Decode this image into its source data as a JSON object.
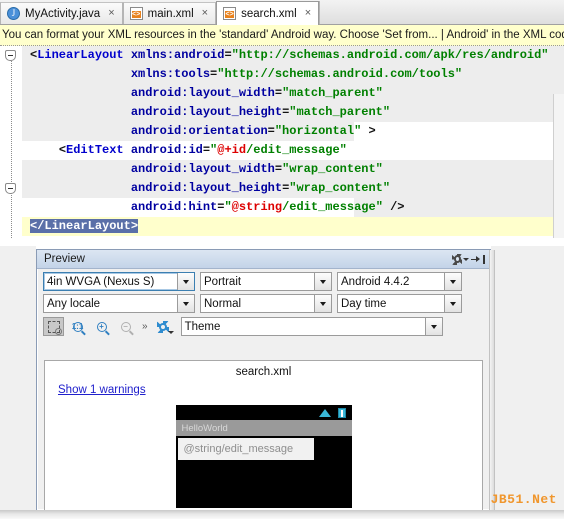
{
  "tabs": [
    {
      "label": "MyActivity.java",
      "icon": "java-file-icon",
      "active": false,
      "close": "×"
    },
    {
      "label": "main.xml",
      "icon": "xml-file-icon",
      "active": false,
      "close": "×"
    },
    {
      "label": "search.xml",
      "icon": "xml-file-icon",
      "active": true,
      "close": "×"
    }
  ],
  "banner": {
    "text": "You can format your XML resources in the 'standard' Android way. Choose 'Set from... | Android' in the XML code sty"
  },
  "editor": {
    "lines": [
      {
        "indent": 0,
        "tokens": [
          {
            "t": "punct",
            "s": "<"
          },
          {
            "t": "tag",
            "s": "LinearLayout"
          },
          {
            "t": "plain",
            "s": " "
          },
          {
            "t": "attr",
            "s": "xmlns:android"
          },
          {
            "t": "punct",
            "s": "="
          },
          {
            "t": "val",
            "s": "\"http://schemas.android.com/apk/res/android\""
          }
        ]
      },
      {
        "indent": 14,
        "tokens": [
          {
            "t": "attr",
            "s": "xmlns:tools"
          },
          {
            "t": "punct",
            "s": "="
          },
          {
            "t": "val",
            "s": "\"http://schemas.android.com/tools\""
          }
        ]
      },
      {
        "indent": 14,
        "tokens": [
          {
            "t": "attr",
            "s": "android:layout_width"
          },
          {
            "t": "punct",
            "s": "="
          },
          {
            "t": "val",
            "s": "\"match_parent\""
          }
        ]
      },
      {
        "indent": 14,
        "tokens": [
          {
            "t": "attr",
            "s": "android:layout_height"
          },
          {
            "t": "punct",
            "s": "="
          },
          {
            "t": "val",
            "s": "\"match_parent\""
          }
        ]
      },
      {
        "indent": 14,
        "tokens": [
          {
            "t": "attr",
            "s": "android:orientation"
          },
          {
            "t": "punct",
            "s": "="
          },
          {
            "t": "val",
            "s": "\"horizontal\""
          },
          {
            "t": "plain",
            "s": " "
          },
          {
            "t": "punct",
            "s": ">"
          }
        ]
      },
      {
        "indent": 4,
        "tokens": [
          {
            "t": "punct",
            "s": "<"
          },
          {
            "t": "tag",
            "s": "EditText"
          },
          {
            "t": "plain",
            "s": " "
          },
          {
            "t": "attr",
            "s": "android:id"
          },
          {
            "t": "punct",
            "s": "="
          },
          {
            "t": "val",
            "s": "\""
          },
          {
            "t": "res",
            "s": "@+id"
          },
          {
            "t": "val",
            "s": "/edit_message\""
          }
        ]
      },
      {
        "indent": 14,
        "tokens": [
          {
            "t": "attr",
            "s": "android:layout_width"
          },
          {
            "t": "punct",
            "s": "="
          },
          {
            "t": "val",
            "s": "\"wrap_content\""
          }
        ]
      },
      {
        "indent": 14,
        "tokens": [
          {
            "t": "attr",
            "s": "android:layout_height"
          },
          {
            "t": "punct",
            "s": "="
          },
          {
            "t": "val",
            "s": "\"wrap_content\""
          }
        ]
      },
      {
        "indent": 14,
        "tokens": [
          {
            "t": "attr",
            "s": "android:hint"
          },
          {
            "t": "punct",
            "s": "="
          },
          {
            "t": "val",
            "s": "\""
          },
          {
            "t": "res",
            "s": "@string"
          },
          {
            "t": "val",
            "s": "/edit_message\""
          },
          {
            "t": "plain",
            "s": " "
          },
          {
            "t": "punct",
            "s": "/>"
          }
        ]
      },
      {
        "indent": 0,
        "selected": true,
        "tokens": [
          {
            "t": "punct",
            "s": "</"
          },
          {
            "t": "tag",
            "s": "LinearLayout"
          },
          {
            "t": "punct",
            "s": ">"
          }
        ]
      }
    ]
  },
  "preview": {
    "title": "Preview",
    "gear_icon": "gear-icon",
    "hide_icon": "hide-panel-icon",
    "combos": [
      {
        "name": "device-combo",
        "value": "4in WVGA (Nexus S)",
        "focused": true
      },
      {
        "name": "orientation-combo",
        "value": "Portrait",
        "focused": false
      },
      {
        "name": "api-combo",
        "value": "Android 4.4.2",
        "focused": false
      },
      {
        "name": "locale-combo",
        "value": "Any locale",
        "focused": false
      },
      {
        "name": "uimode-combo",
        "value": "Normal",
        "focused": false
      },
      {
        "name": "nightmode-combo",
        "value": "Day time",
        "focused": false
      }
    ],
    "theme_combo": {
      "name": "theme-combo",
      "value": "Theme"
    },
    "toolbar_icons": [
      "zoom-to-fit-icon",
      "zoom-actual-size-icon",
      "zoom-in-icon",
      "zoom-out-icon",
      "overflow-chevron-icon",
      "render-options-gear-icon"
    ],
    "render": {
      "file_title": "search.xml",
      "warnings_link": "Show 1 warnings",
      "device": {
        "app_bar_title": "HelloWorld",
        "edit_text_hint": "@string/edit_message",
        "wifi_icon": "wifi-icon",
        "battery_icon": "battery-icon"
      }
    }
  },
  "watermark": "JB51.Net"
}
